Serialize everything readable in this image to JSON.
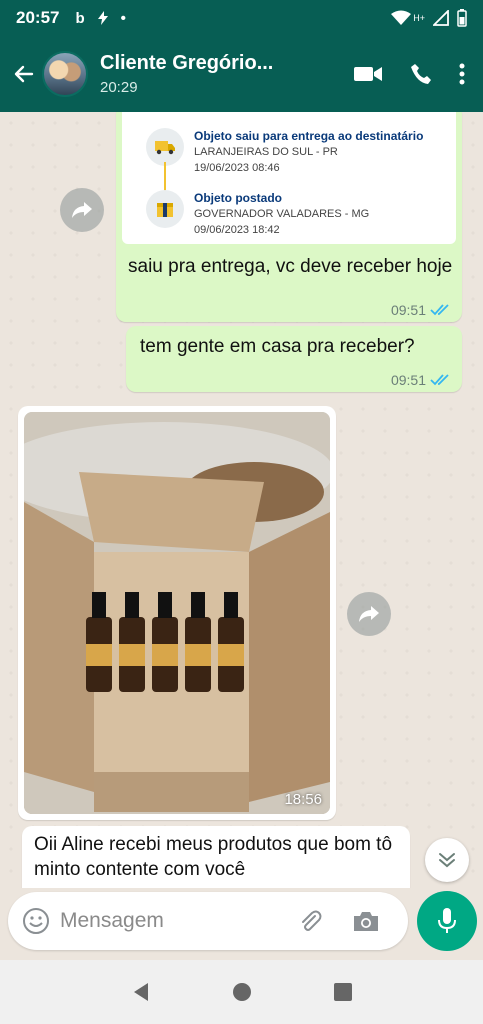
{
  "status_bar": {
    "time": "20:57",
    "left_glyph_b": "b",
    "dot": "•",
    "network": "H+"
  },
  "header": {
    "contact_name": "Cliente Gregório...",
    "last_seen": "20:29"
  },
  "messages": {
    "tracking": {
      "item1_title": "Objeto saiu para entrega ao destinatário",
      "item1_location": "LARANJEIRAS DO SUL - PR",
      "item1_datetime": "19/06/2023 08:46",
      "item2_title": "Objeto postado",
      "item2_location": "GOVERNADOR VALADARES - MG",
      "item2_datetime": "09/06/2023 18:42"
    },
    "m1": {
      "text": "saiu pra entrega, vc deve receber hoje",
      "time": "09:51"
    },
    "m2": {
      "text": "tem gente em casa pra receber?",
      "time": "09:51"
    },
    "photo": {
      "time": "18:56"
    },
    "m3": {
      "text": "Oii Aline recebi  meus produtos que bom  tô minto contente com você"
    }
  },
  "input": {
    "placeholder": "Mensagem"
  },
  "colors": {
    "header": "#075e54",
    "outgoing_bubble": "#dcf8c6",
    "tick_blue": "#34b7f1",
    "mic_green": "#00a884"
  }
}
